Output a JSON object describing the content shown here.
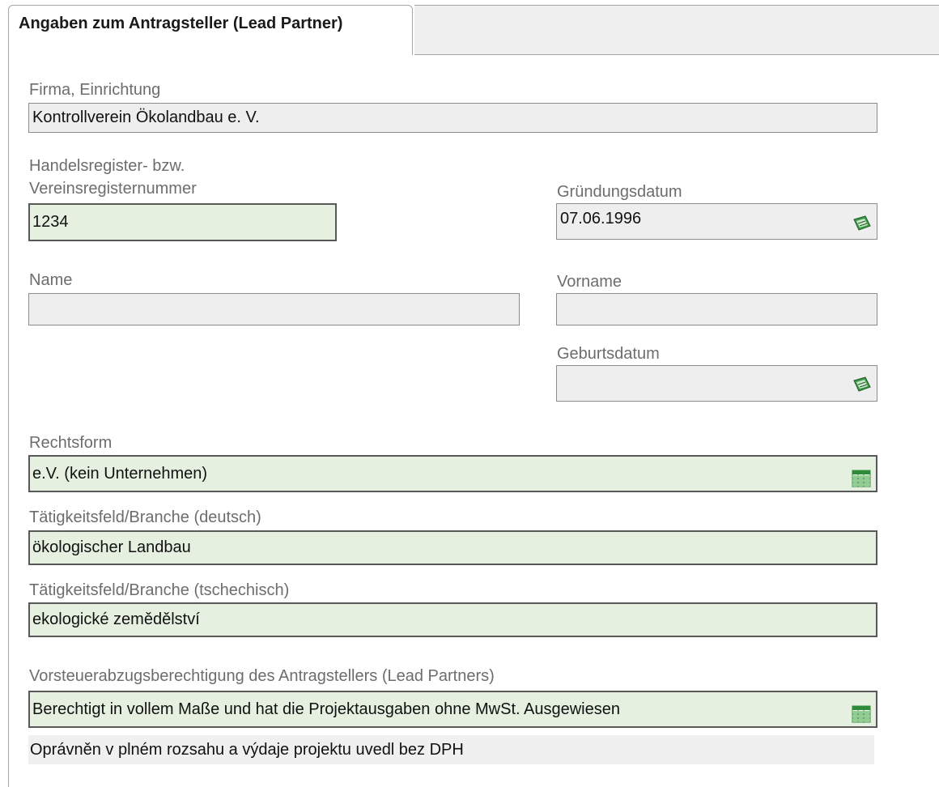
{
  "tab": {
    "active_label": "Angaben zum Antragsteller (Lead Partner)"
  },
  "form": {
    "firma": {
      "label": "Firma, Einrichtung",
      "value": "Kontrollverein Ökolandbau e. V."
    },
    "register": {
      "label_line1": "Handelsregister- bzw.",
      "label_line2": "Vereinsregisternummer",
      "value": "1234"
    },
    "gruendung": {
      "label": "Gründungsdatum",
      "value": "07.06.1996",
      "icon": "calendar-icon"
    },
    "name": {
      "label": "Name",
      "value": ""
    },
    "vorname": {
      "label": "Vorname",
      "value": ""
    },
    "geburt": {
      "label": "Geburtsdatum",
      "value": "",
      "icon": "calendar-icon"
    },
    "rechtsform": {
      "label": "Rechtsform",
      "value": "e.V. (kein Unternehmen)",
      "icon": "list-picker-icon"
    },
    "branche_de": {
      "label": "Tätigkeitsfeld/Branche (deutsch)",
      "value": "ökologischer Landbau"
    },
    "branche_cz": {
      "label": "Tätigkeitsfeld/Branche (tschechisch)",
      "value": "ekologické zemědělství"
    },
    "vorsteuer": {
      "label": "Vorsteuerabzugsberechtigung des Antragstellers (Lead Partners)",
      "value": "Berechtigt in vollem Maße und hat die Projektausgaben ohne MwSt. Ausgewiesen",
      "icon": "list-picker-icon",
      "translation": "Oprávněn v plném rozsahu a výdaje projektu uvedl bez DPH"
    }
  },
  "colors": {
    "required_field_bg": "#e6f0e0",
    "field_bg": "#eeeeee",
    "label": "#6d6d6d",
    "icon_green": "#2e8b3a"
  }
}
